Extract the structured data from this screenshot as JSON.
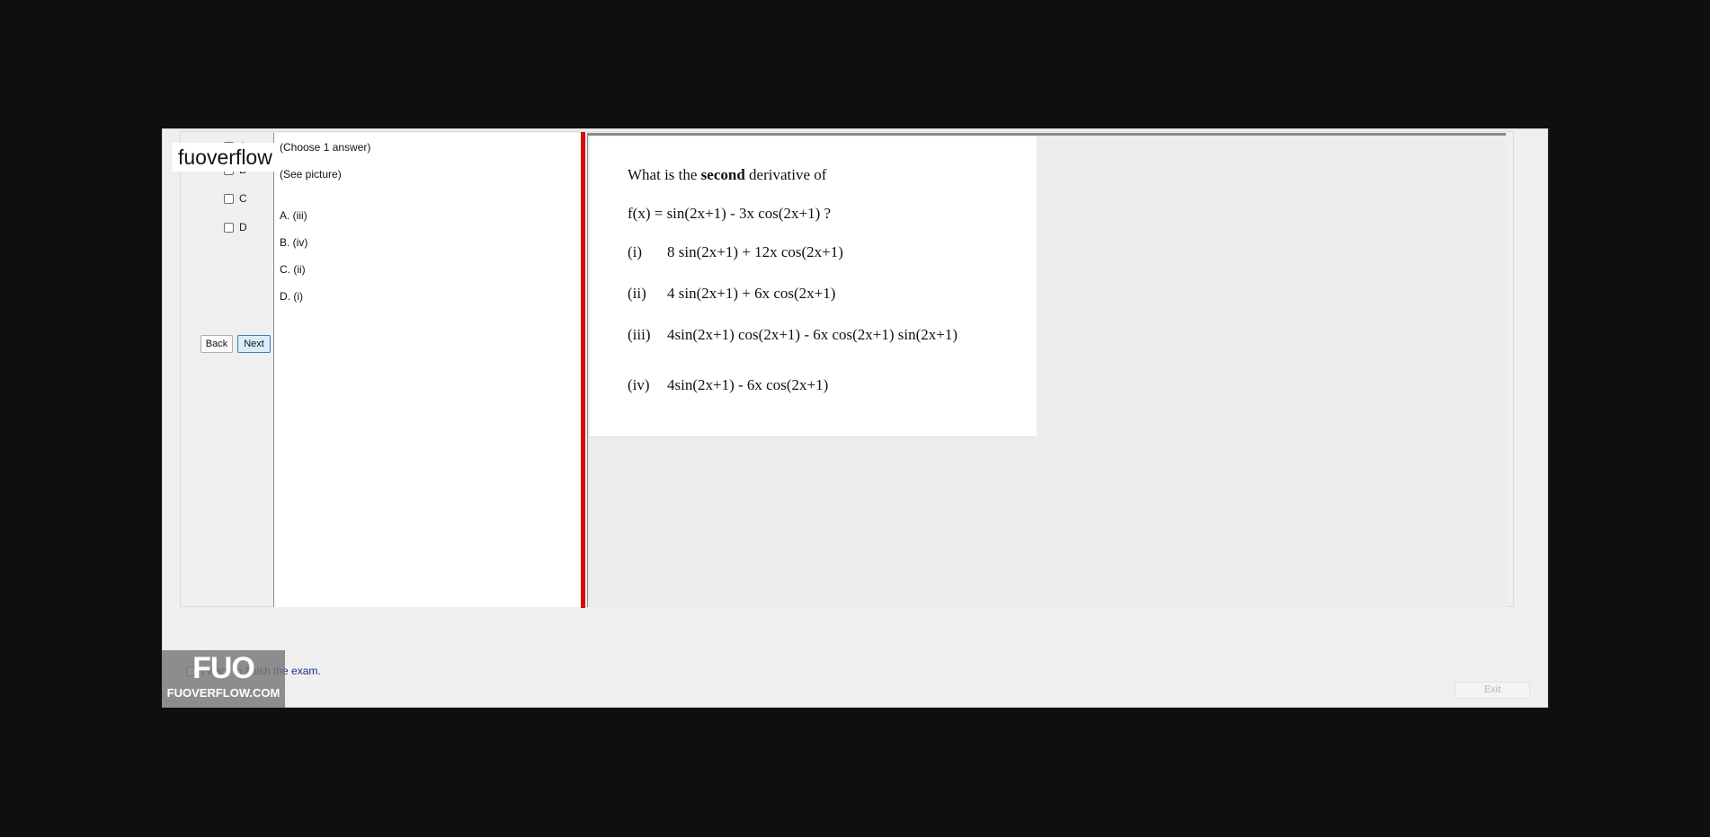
{
  "watermark": {
    "top_text": "fuoverflow",
    "logo": "FUO",
    "site": "FUOVERFLOW.COM"
  },
  "options": {
    "letters": [
      "A",
      "B",
      "C",
      "D"
    ],
    "back_label": "Back",
    "next_label": "Next"
  },
  "answer_panel": {
    "instruction": "(Choose 1 answer)",
    "see_picture": "(See picture)",
    "choices": [
      "A. (iii)",
      "B. (iv)",
      "C. (ii)",
      "D. (i)"
    ]
  },
  "question": {
    "prefix": "What is the ",
    "bold": "second",
    "suffix": " derivative of",
    "function": "f(x) = sin(2x+1) - 3x cos(2x+1) ?",
    "items": [
      {
        "num": "(i)",
        "text": "8 sin(2x+1) + 12x cos(2x+1)"
      },
      {
        "num": "(ii)",
        "text": "4 sin(2x+1) + 6x cos(2x+1)"
      },
      {
        "num": "(iii)",
        "text": "4sin(2x+1) cos(2x+1) - 6x cos(2x+1) sin(2x+1)"
      },
      {
        "num": "(iv)",
        "text": "4sin(2x+1) - 6x cos(2x+1)"
      }
    ]
  },
  "footer": {
    "finish_label": "I want to finish the exam.",
    "exit_label": "Exit"
  },
  "colors": {
    "divider": "#d60b0b",
    "next_button_bg": "#d9ecf9",
    "finish_text": "#1b2e8c"
  }
}
